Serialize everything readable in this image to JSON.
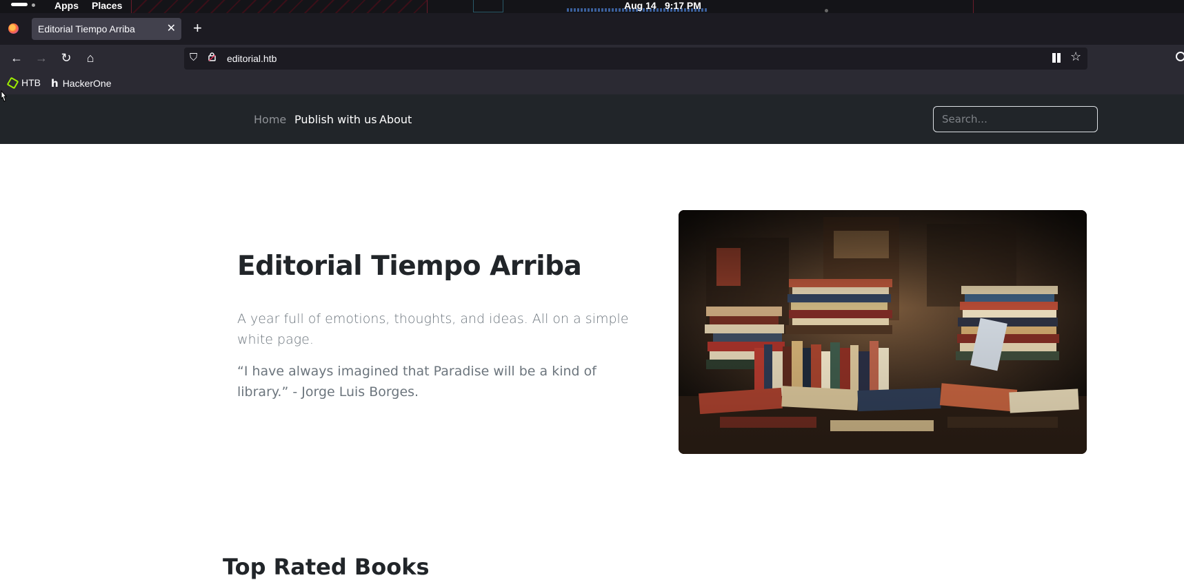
{
  "os_bar": {
    "apps_label": "Apps",
    "places_label": "Places",
    "date": "Aug 14",
    "time": "9:17 PM"
  },
  "browser": {
    "tab_title": "Editorial Tiempo Arriba",
    "url": "editorial.htb",
    "bookmarks": [
      {
        "label": "HTB",
        "icon": "htb-cube-icon"
      },
      {
        "label": "HackerOne",
        "icon": "hackerone-icon"
      }
    ]
  },
  "site": {
    "nav": {
      "home_label": "Home",
      "publish_label": "Publish with us",
      "about_label": "About"
    },
    "search_placeholder": "Search...",
    "hero": {
      "title": "Editorial Tiempo Arriba",
      "lead": "A year full of emotions, thoughts, and ideas. All on a simple white page.",
      "quote": "“I have always imagined that Paradise will be a kind of library.” - Jorge Luis Borges."
    },
    "section_title": "Top Rated Books"
  },
  "colors": {
    "navbar_bg": "#212529",
    "browser_chrome": "#2b2a33",
    "text_muted": "#6c757d"
  }
}
